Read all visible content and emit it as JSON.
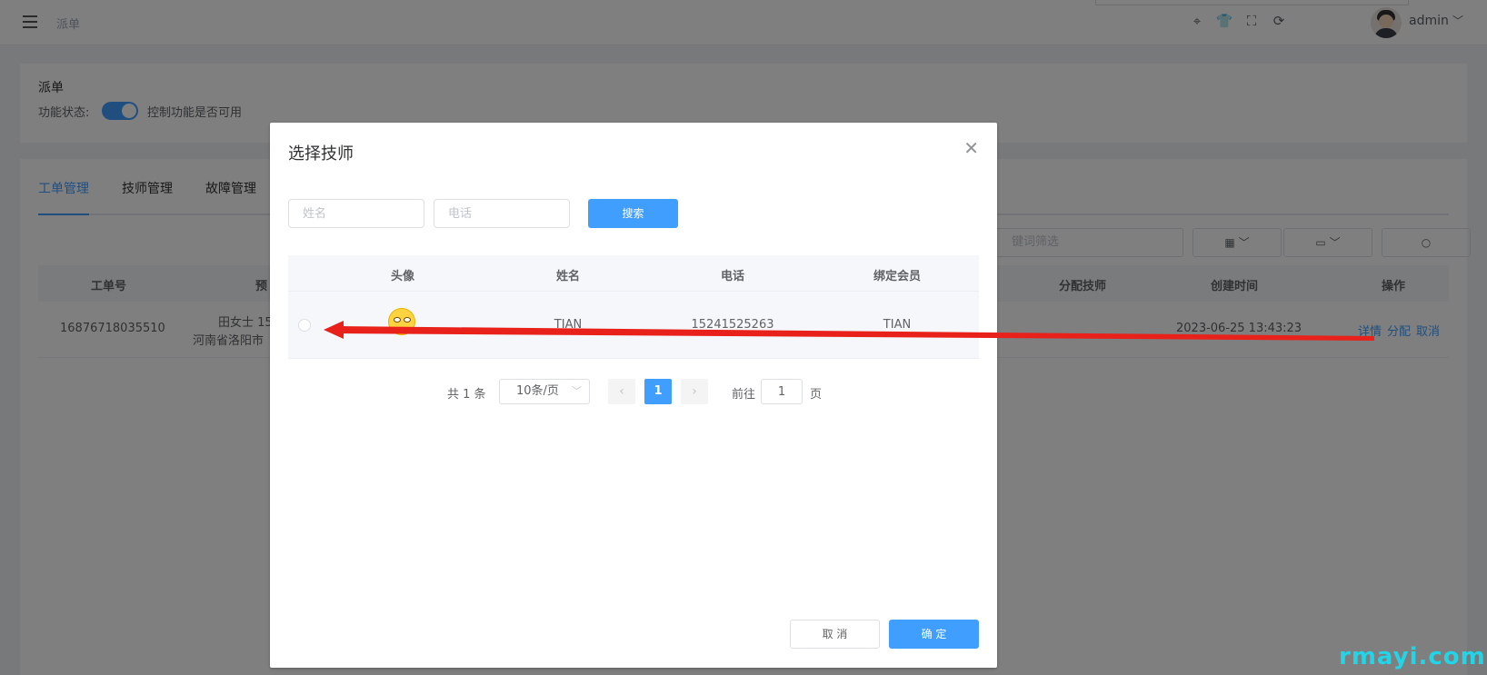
{
  "topbar": {
    "breadcrumb": "派单",
    "user": "admin"
  },
  "feature_card": {
    "title": "派单",
    "status_label": "功能状态:",
    "switch_on": true,
    "switch_text": "控制功能是否可用"
  },
  "tabs": [
    "工单管理",
    "技师管理",
    "故障管理"
  ],
  "filter": {
    "placeholder_partial": "键词筛选"
  },
  "table": {
    "headers": [
      "工单号",
      "预",
      "分配技师",
      "创建时间",
      "操作"
    ],
    "row": {
      "order_no": "16876718035510",
      "contact_line1": "田女士 15",
      "contact_line2": "河南省洛阳市",
      "created": "2023-06-25 13:43:23",
      "actions": [
        "详情",
        "分配",
        "取消"
      ]
    }
  },
  "dialog": {
    "title": "选择技师",
    "name_placeholder": "姓名",
    "phone_placeholder": "电话",
    "search_label": "搜索",
    "headers": [
      "头像",
      "姓名",
      "电话",
      "绑定会员"
    ],
    "rows": [
      {
        "name": "TIAN",
        "phone": "15241525263",
        "member": "TIAN"
      }
    ],
    "pager": {
      "total": "共 1 条",
      "page_size": "10条/页",
      "prev": "‹",
      "next": "›",
      "current": "1",
      "goto_label": "前往",
      "goto_value": "1",
      "page_unit": "页"
    },
    "cancel_label": "取 消",
    "confirm_label": "确 定"
  },
  "watermark": "rmayi.com",
  "colors": {
    "primary": "#409eff",
    "annotation_arrow": "#e8211b",
    "watermark": "#21d4e8"
  }
}
